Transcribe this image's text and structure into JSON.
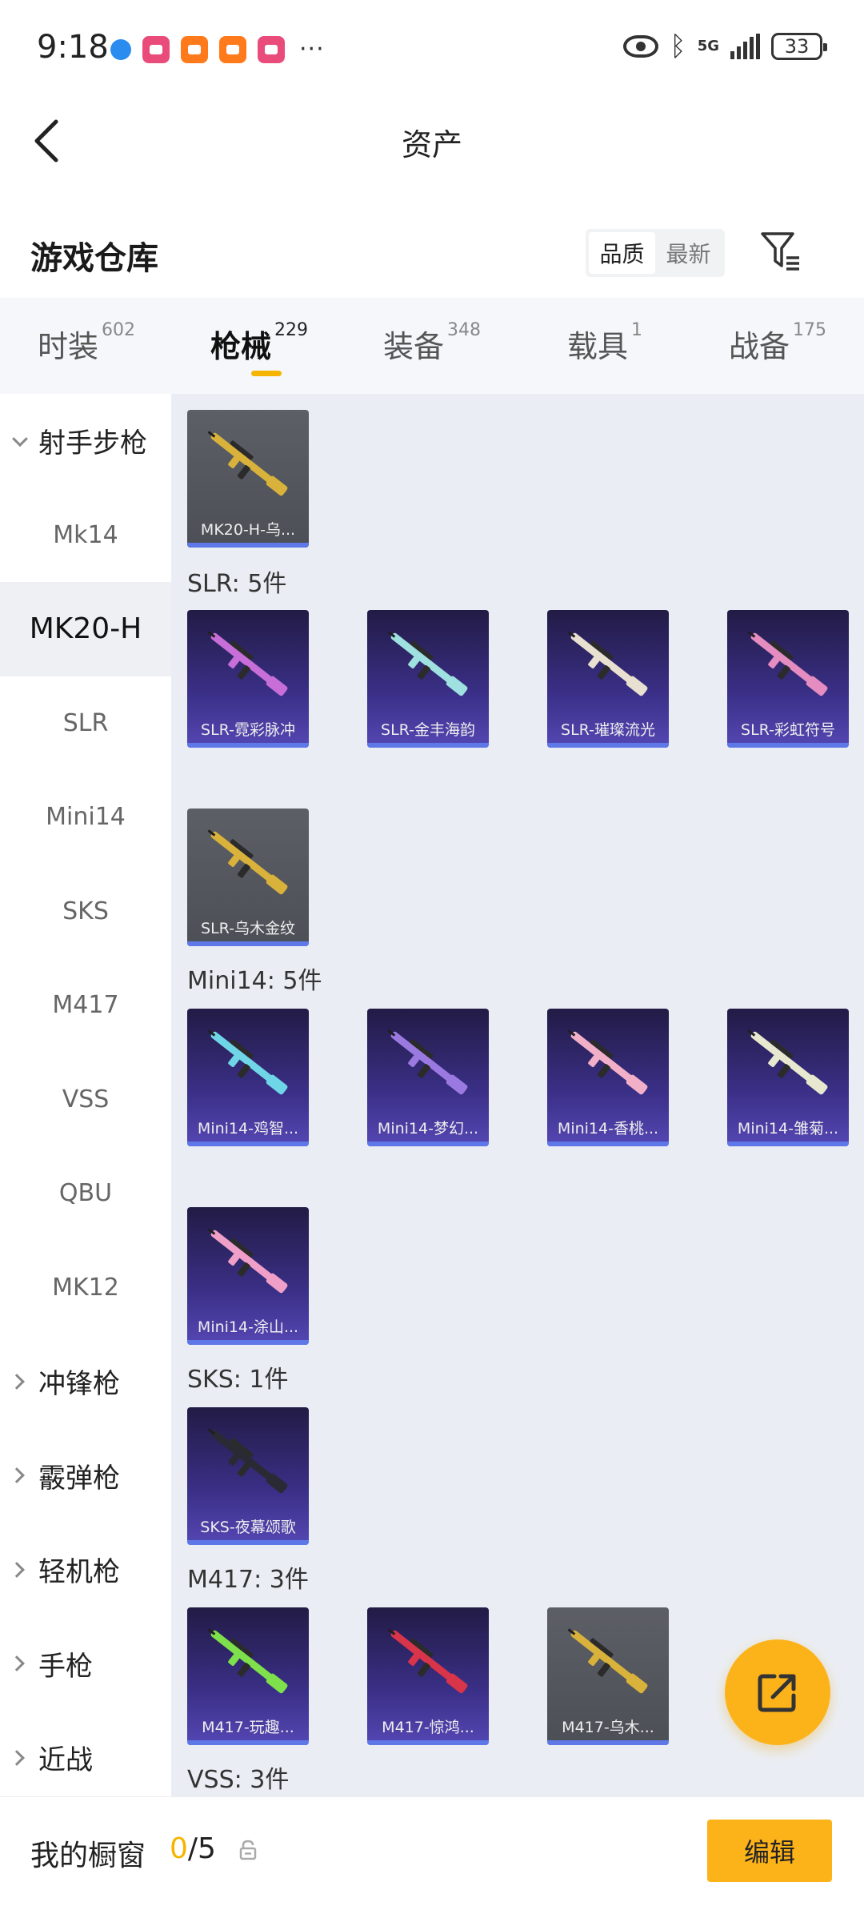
{
  "status_bar": {
    "time": "9:18",
    "more": "···",
    "network": "5G",
    "battery": "33",
    "icons": [
      "browser-dot-icon",
      "app-pink-icon",
      "app-orange-icon",
      "app-orange-icon",
      "app-pink-icon",
      "eye-icon",
      "bluetooth-icon",
      "signal-icon",
      "battery-icon"
    ]
  },
  "header": {
    "title": "资产",
    "back_icon": "chevron-left-icon"
  },
  "warehouse": {
    "title": "游戏仓库",
    "sort_options": [
      "品质",
      "最新"
    ],
    "sort_selected": "品质",
    "filter_icon": "filter-icon"
  },
  "tabs": [
    {
      "label": "时装",
      "count": "602",
      "active": false
    },
    {
      "label": "枪械",
      "count": "229",
      "active": true
    },
    {
      "label": "装备",
      "count": "348",
      "active": false
    },
    {
      "label": "载具",
      "count": "1",
      "active": false
    },
    {
      "label": "战备",
      "count": "175",
      "active": false
    }
  ],
  "sidebar": {
    "items": [
      {
        "label": "射手步枪",
        "type": "group",
        "expanded": true
      },
      {
        "label": "Mk14",
        "type": "sub"
      },
      {
        "label": "MK20-H",
        "type": "sub",
        "active": true
      },
      {
        "label": "SLR",
        "type": "sub"
      },
      {
        "label": "Mini14",
        "type": "sub"
      },
      {
        "label": "SKS",
        "type": "sub"
      },
      {
        "label": "M417",
        "type": "sub"
      },
      {
        "label": "VSS",
        "type": "sub"
      },
      {
        "label": "QBU",
        "type": "sub"
      },
      {
        "label": "MK12",
        "type": "sub"
      },
      {
        "label": "冲锋枪",
        "type": "group",
        "expanded": false
      },
      {
        "label": "霰弹枪",
        "type": "group",
        "expanded": false
      },
      {
        "label": "轻机枪",
        "type": "group",
        "expanded": false
      },
      {
        "label": "手枪",
        "type": "group",
        "expanded": false
      },
      {
        "label": "近战",
        "type": "group",
        "expanded": false
      }
    ]
  },
  "groups": {
    "slr": "SLR: 5件",
    "mini14": "Mini14: 5件",
    "sks": "SKS: 1件",
    "m417": "M417: 3件",
    "vss": "VSS: 3件"
  },
  "items": {
    "mk20_1": {
      "name": "MK20-H-乌...",
      "style": "gray",
      "accent": "#d8b23a"
    },
    "slr_1": {
      "name": "SLR-霓彩脉冲",
      "style": "purple",
      "accent": "#c86ed8"
    },
    "slr_2": {
      "name": "SLR-金丰海韵",
      "style": "purple",
      "accent": "#9fe0e0"
    },
    "slr_3": {
      "name": "SLR-璀璨流光",
      "style": "purple",
      "accent": "#e8e0d0"
    },
    "slr_4": {
      "name": "SLR-彩虹符号",
      "style": "purple",
      "accent": "#e58cc0"
    },
    "slr_5": {
      "name": "SLR-乌木金纹",
      "style": "gray",
      "accent": "#d8b23a"
    },
    "mini_1": {
      "name": "Mini14-鸡智...",
      "style": "purple",
      "accent": "#6fd6e8"
    },
    "mini_2": {
      "name": "Mini14-梦幻...",
      "style": "purple",
      "accent": "#9a7ae0"
    },
    "mini_3": {
      "name": "Mini14-香桃...",
      "style": "purple",
      "accent": "#f2b0c8"
    },
    "mini_4": {
      "name": "Mini14-雏菊...",
      "style": "purple",
      "accent": "#e8e8d0"
    },
    "mini_5": {
      "name": "Mini14-涂山...",
      "style": "purple",
      "accent": "#f0a0c8"
    },
    "sks_1": {
      "name": "SKS-夜幕颂歌",
      "style": "purple",
      "accent": "#2a2a35"
    },
    "m417_1": {
      "name": "M417-玩趣...",
      "style": "purple",
      "accent": "#7ee04a"
    },
    "m417_2": {
      "name": "M417-惊鸿...",
      "style": "purple",
      "accent": "#d8344a"
    },
    "m417_3": {
      "name": "M417-乌木...",
      "style": "gray",
      "accent": "#d8b23a"
    }
  },
  "fab": {
    "icon": "share-external-icon"
  },
  "bottom_bar": {
    "label": "我的橱窗",
    "current": "0",
    "total": "/5",
    "lock_icon": "lock-icon",
    "edit_label": "编辑"
  }
}
